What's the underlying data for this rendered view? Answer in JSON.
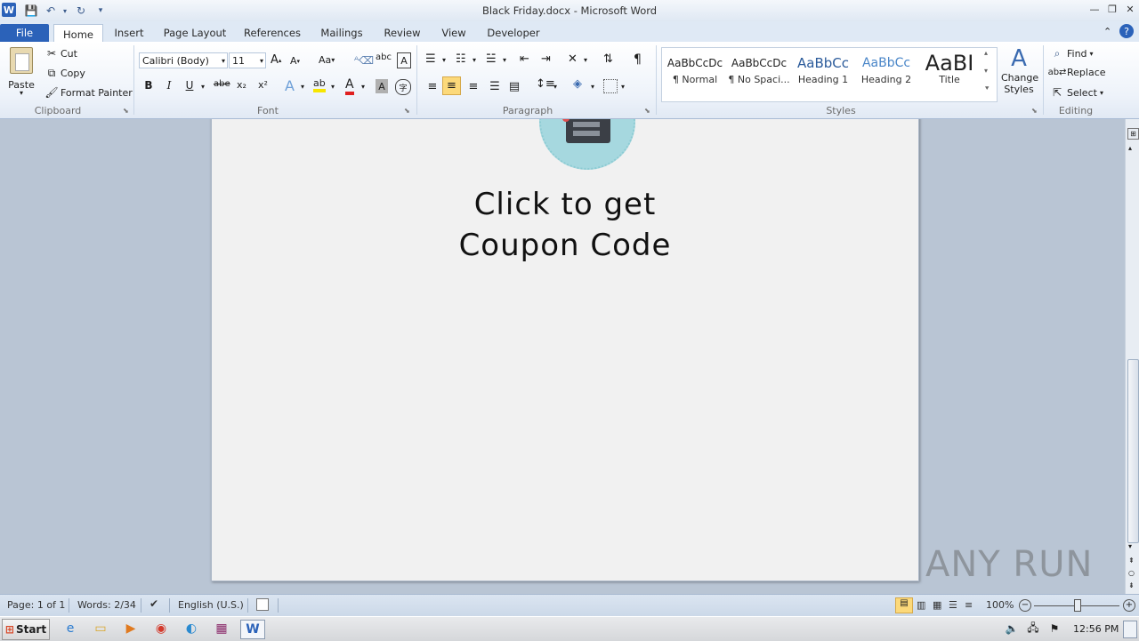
{
  "window": {
    "title": "Black Friday.docx - Microsoft Word"
  },
  "tabs": [
    "File",
    "Home",
    "Insert",
    "Page Layout",
    "References",
    "Mailings",
    "Review",
    "View",
    "Developer"
  ],
  "clipboard": {
    "paste": "Paste",
    "cut": "Cut",
    "copy": "Copy",
    "format_painter": "Format Painter",
    "label": "Clipboard"
  },
  "font": {
    "family": "Calibri (Body)",
    "size": "11",
    "label": "Font",
    "bold": "B",
    "italic": "I",
    "underline": "U",
    "strike": "abe",
    "sub": "x₂",
    "sup": "x²",
    "change_case": "Aa"
  },
  "paragraph": {
    "label": "Paragraph",
    "pilcrow": "¶"
  },
  "styles": {
    "label": "Styles",
    "items": [
      {
        "sample": "AaBbCcDc",
        "name": "¶ Normal"
      },
      {
        "sample": "AaBbCcDc",
        "name": "¶ No Spaci..."
      },
      {
        "sample": "AaBbCc",
        "name": "Heading 1"
      },
      {
        "sample": "AaBbCc",
        "name": "Heading 2"
      },
      {
        "sample": "AaBI",
        "name": "Title"
      }
    ],
    "change_styles": "Change Styles"
  },
  "editing": {
    "label": "Editing",
    "find": "Find",
    "replace": "Replace",
    "select": "Select"
  },
  "document": {
    "line1": "Click to get",
    "line2": "Coupon Code"
  },
  "status": {
    "page": "Page: 1 of 1",
    "words": "Words: 2/34",
    "language": "English (U.S.)",
    "zoom": "100%"
  },
  "taskbar": {
    "start": "Start",
    "clock": "12:56 PM"
  },
  "watermark": "ANY RUN",
  "colors": {
    "file_tab": "#2b62b9",
    "accent": "#3b5b8c"
  }
}
